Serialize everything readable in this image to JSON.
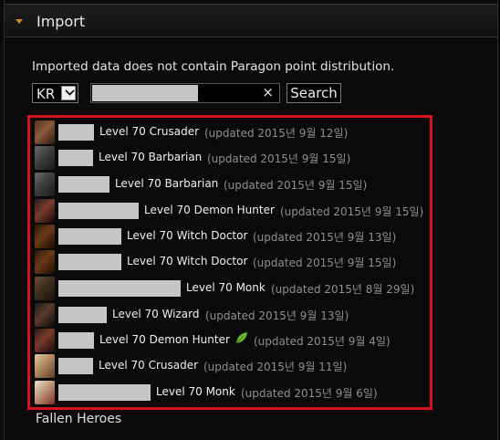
{
  "header": {
    "title": "Import"
  },
  "note": "Imported data does not contain Paragon point distribution.",
  "region": {
    "value": "KR"
  },
  "search": {
    "clear_label": "×",
    "button_label": "Search"
  },
  "heroes": [
    {
      "level_text": "Level 70 Crusader",
      "updated": "(updated 2015년 9월 12일)",
      "portrait": "crusader-male-portrait"
    },
    {
      "level_text": "Level 70 Barbarian",
      "updated": "(updated 2015년 9월 15일)",
      "portrait": "barbarian-portrait"
    },
    {
      "level_text": "Level 70 Barbarian",
      "updated": "(updated 2015년 9월 15일)",
      "portrait": "barbarian-portrait"
    },
    {
      "level_text": "Level 70 Demon Hunter",
      "updated": "(updated 2015년 9월 15일)",
      "portrait": "demon-hunter-portrait"
    },
    {
      "level_text": "Level 70 Witch Doctor",
      "updated": "(updated 2015년 9월 13일)",
      "portrait": "witch-doctor-portrait"
    },
    {
      "level_text": "Level 70 Witch Doctor",
      "updated": "(updated 2015년 9월 15일)",
      "portrait": "witch-doctor-portrait"
    },
    {
      "level_text": "Level 70 Monk",
      "updated": "(updated 2015년 8월 29일)",
      "portrait": "monk-male-portrait"
    },
    {
      "level_text": "Level 70 Wizard",
      "updated": "(updated 2015년 9월 13일)",
      "portrait": "wizard-portrait"
    },
    {
      "level_text": "Level 70 Demon Hunter",
      "updated": "(updated 2015년 9월 4일)",
      "portrait": "demon-hunter-portrait",
      "seasonal_icon": "leaf-icon"
    },
    {
      "level_text": "Level 70 Crusader",
      "updated": "(updated 2015년 9월 11일)",
      "portrait": "crusader-female-portrait"
    },
    {
      "level_text": "Level 70 Monk",
      "updated": "(updated 2015년 9월 6일)",
      "portrait": "monk-female-portrait"
    }
  ],
  "fallen_heroes": "Fallen Heroes",
  "colors": {
    "accent_arrow": "#d98a2b",
    "highlight_border": "#d4141c",
    "leaf": "#6fbf3a"
  }
}
